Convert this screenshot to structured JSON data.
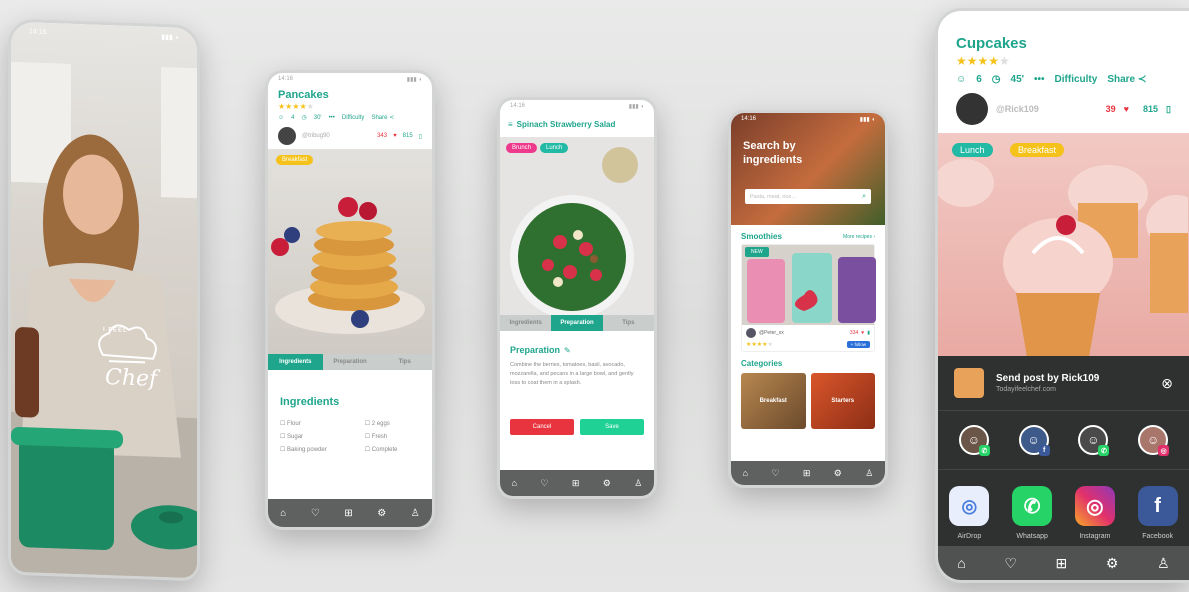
{
  "status_bar": {
    "time": "14:16",
    "signal": "▮▮▮ ◖"
  },
  "phone1": {
    "logo_line1": "I FEEL",
    "logo_line2": "Chef"
  },
  "phone2": {
    "title": "Pancakes",
    "rating": 4,
    "servings": "4",
    "time": "30'",
    "difficulty_label": "Difficulty",
    "share_label": "Share",
    "user": "@tribug90",
    "likes": "343",
    "saves": "815",
    "category_chip": "Breakfast",
    "tabs": [
      "Ingredients",
      "Preparation",
      "Tips"
    ],
    "active_tab": 0,
    "section_title": "Ingredients",
    "ingredients_left": [
      "Flour",
      "Sugar",
      "Baking powder"
    ],
    "ingredients_right": [
      "2 eggs",
      "Fresh",
      "Complete"
    ]
  },
  "phone3": {
    "title": "Spinach Strawberry Salad",
    "chips": [
      "Brunch",
      "Lunch"
    ],
    "tabs": [
      "Ingredients",
      "Preparation",
      "Tips"
    ],
    "active_tab": 1,
    "section_title": "Preparation",
    "body": "Combine the berries, tomatoes, basil, avocado, mozzarella, and pecans in a large bowl, and gently toss to coat them in a splash.",
    "cancel_label": "Cancel",
    "save_label": "Save"
  },
  "phone4": {
    "hero_title": "Search by ingredients",
    "search_placeholder": "Pasta, meat, rice...",
    "smoothies_title": "Smoothies",
    "more_recipes": "More recipes ›",
    "new_badge": "NEW",
    "card_user": "@Peter_xx",
    "card_likes": "334",
    "follow_label": "+ follow",
    "card_rating": 4,
    "categories_title": "Categories",
    "category_tiles": [
      "Breakfast",
      "Starters"
    ]
  },
  "phone5": {
    "title": "Cupcakes",
    "rating": 4,
    "servings": "6",
    "time": "45'",
    "difficulty_label": "Difficulty",
    "share_label": "Share",
    "user": "@Rick109",
    "likes": "39",
    "saves": "815",
    "chips": [
      "Lunch",
      "Breakfast"
    ],
    "share_sheet_title": "Send post by Rick109",
    "share_sheet_url": "Todayifeelchef.com",
    "apps": [
      {
        "label": "AirDrop",
        "icon": "airdrop-icon",
        "color": "#e8eefc"
      },
      {
        "label": "Whatsapp",
        "icon": "whatsapp-icon",
        "color": "#25d366"
      },
      {
        "label": "Instagram",
        "icon": "instagram-icon",
        "color": "#e1306c"
      },
      {
        "label": "Facebook",
        "icon": "facebook-icon",
        "color": "#3b5998"
      }
    ]
  },
  "colors": {
    "accent": "#1fa58c",
    "chip_yellow": "#f4c21a",
    "chip_pink": "#ee3a8c",
    "chip_teal": "#22b9a5",
    "cancel": "#e8343f",
    "save": "#1fd195",
    "heart": "#e8343f",
    "nav": "#5e6160",
    "share_sheet": "#2f3030"
  }
}
